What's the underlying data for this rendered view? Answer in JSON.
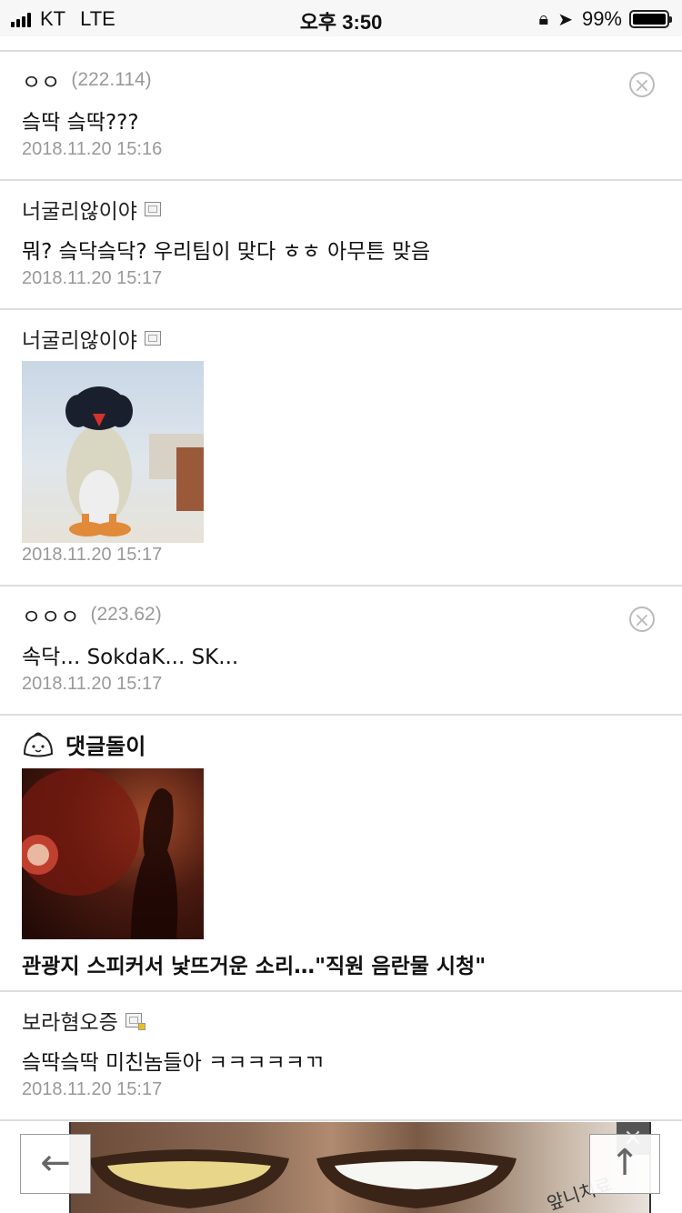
{
  "status_bar": {
    "carrier": "KT",
    "network": "LTE",
    "time": "오후 3:50",
    "battery": "99%"
  },
  "comments": [
    {
      "author": "ㅇㅇ",
      "ip": "(222.114)",
      "text": "슼딱 슼딱???",
      "date": "2018.11.20 15:16",
      "deletable": true
    },
    {
      "author": "너굴리않이야",
      "text": "뭐? 슼닥슼닥? 우리팀이 맞다 ㅎㅎ 아무튼 맞음",
      "date": "2018.11.20 15:17"
    },
    {
      "author": "너굴리않이야",
      "image": "penguin-photo",
      "date": "2018.11.20 15:17"
    },
    {
      "author": "ㅇㅇㅇ",
      "ip": "(223.62)",
      "text": "속닥... SokdaK... SK...",
      "date": "2018.11.20 15:17",
      "deletable": true
    }
  ],
  "bot": {
    "name": "댓글돌이",
    "news_title": "관광지 스피커서 낯뜨거운 소리…\"직원 음란물 시청\""
  },
  "last_comment": {
    "author": "보라혐오증",
    "text": "슼딱슼딱 미친놈들아 ㅋㅋㅋㅋㅋㄲ",
    "date": "2018.11.20 15:17"
  },
  "ad": {
    "text": "앞니치료"
  },
  "nav": {
    "back": "←",
    "top": "↑"
  }
}
